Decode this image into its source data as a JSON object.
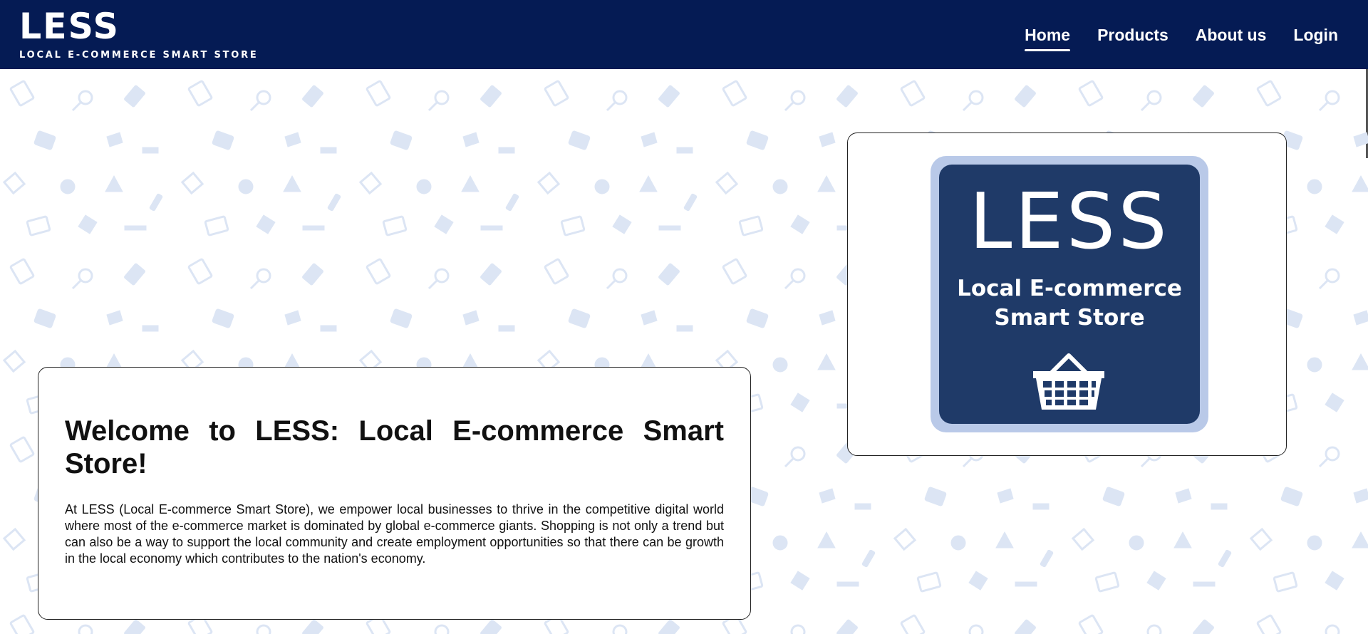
{
  "header": {
    "brand_title": "LESS",
    "brand_subtitle": "LOCAL E-COMMERCE SMART STORE",
    "nav": [
      {
        "label": "Home",
        "active": true
      },
      {
        "label": "Products",
        "active": false
      },
      {
        "label": "About us",
        "active": false
      },
      {
        "label": "Login",
        "active": false
      }
    ]
  },
  "logo_card": {
    "big_text": "LESS",
    "line1": "Local E-commerce",
    "line2": "Smart Store",
    "icon": "shopping-basket-icon"
  },
  "welcome": {
    "title": "Welcome to LESS: Local E-commerce Smart Store!",
    "body": "At LESS (Local E-commerce Smart Store), we empower local businesses to thrive in the competitive digital world where most of the e-commerce market is dominated by global e-commerce giants. Shopping is not only a trend but can also be a way to support the local community and create employment opportunities so that there can be growth in the local economy which contributes to the nation's economy."
  },
  "colors": {
    "header_bg": "#051b54",
    "pattern_icon": "#dce5f4",
    "logo_tile_bg": "#1f3a68",
    "logo_tile_border": "#b9c9e8"
  }
}
